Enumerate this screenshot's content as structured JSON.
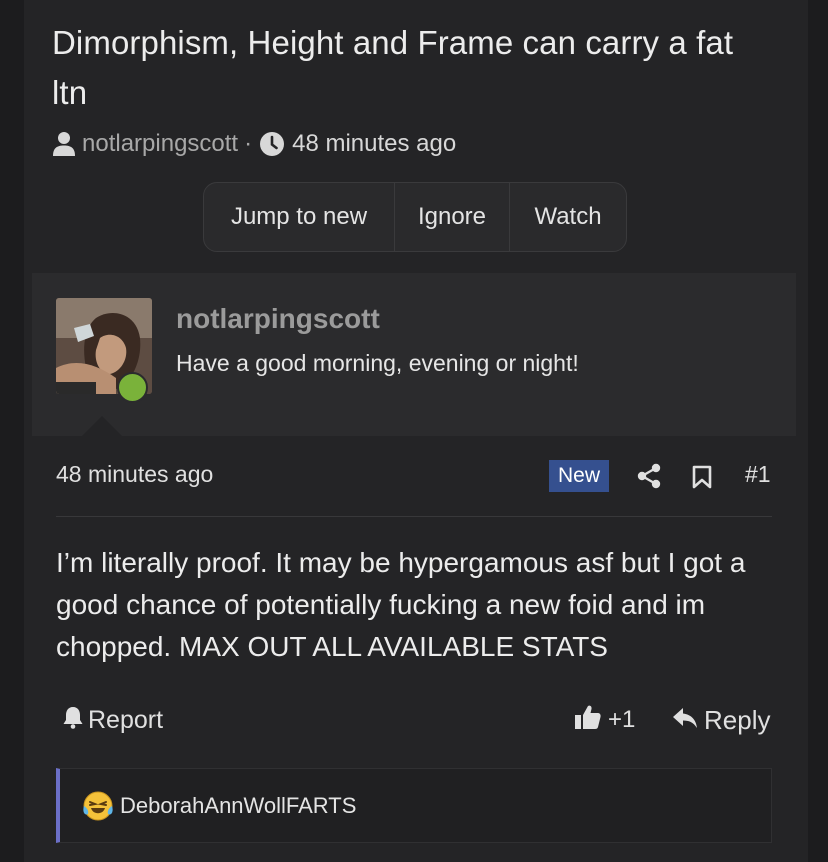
{
  "thread": {
    "title": "Dimorphism, Height and Frame can carry a fat ltn",
    "author": "notlarpingscott",
    "separator": "·",
    "time": "48 minutes ago"
  },
  "actions": {
    "jump_to_new": "Jump to new",
    "ignore": "Ignore",
    "watch": "Watch"
  },
  "user_card": {
    "username": "notlarpingscott",
    "tagline": "Have a good morning, evening or night!",
    "status_color": "#7ab23a"
  },
  "post": {
    "time": "48 minutes ago",
    "badge": "New",
    "number": "#1",
    "body": "I’m literally proof. It may be hypergamous asf but I got a good chance of potentially fucking a new foid and im chopped. MAX OUT ALL AVAILABLE STATS",
    "report_label": "Report",
    "like_count": "+1",
    "reply_label": "Reply"
  },
  "reactions": {
    "emoji": "laughing-crying-emoji",
    "user": "DeborahAnnWollFARTS"
  },
  "colors": {
    "background": "#1c1c1e",
    "panel": "#242426",
    "badge": "#35508f",
    "accent_border": "#6b6fc7"
  }
}
